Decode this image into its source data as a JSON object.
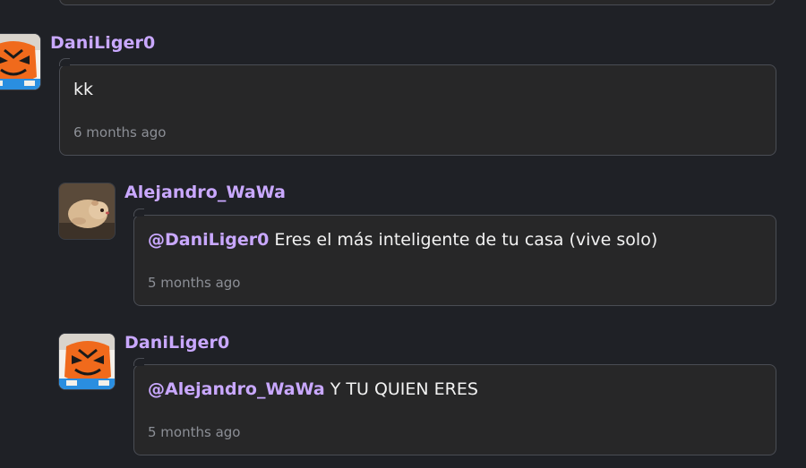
{
  "comments": [
    {
      "author": "DaniLiger0",
      "mention": "",
      "text": "kk",
      "time": "6 months ago",
      "avatar_icon": "tiger-mask-avatar"
    },
    {
      "author": "Alejandro_WaWa",
      "mention": "@DaniLiger0",
      "text": " Eres el más inteligente de tu casa (vive solo)",
      "time": "5 months ago",
      "avatar_icon": "hamster-photo-avatar"
    },
    {
      "author": "DaniLiger0",
      "mention": "@Alejandro_WaWa",
      "text": " Y TU QUIEN ERES",
      "time": "5 months ago",
      "avatar_icon": "tiger-mask-avatar"
    }
  ],
  "colors": {
    "background": "#1f2126",
    "bubble": "#272728",
    "border": "#4a4d54",
    "username": "#c9a8ff",
    "text": "#f2f2f2",
    "timestamp": "#8c8f96"
  }
}
